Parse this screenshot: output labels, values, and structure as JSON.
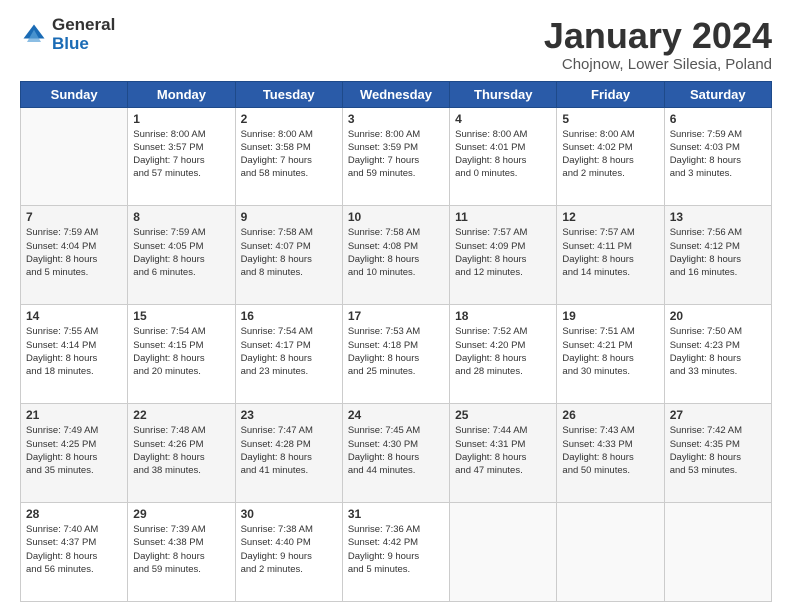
{
  "logo": {
    "general": "General",
    "blue": "Blue"
  },
  "title": {
    "month": "January 2024",
    "location": "Chojnow, Lower Silesia, Poland"
  },
  "weekdays": [
    "Sunday",
    "Monday",
    "Tuesday",
    "Wednesday",
    "Thursday",
    "Friday",
    "Saturday"
  ],
  "weeks": [
    [
      {
        "day": "",
        "sunrise": "",
        "sunset": "",
        "daylight": ""
      },
      {
        "day": "1",
        "sunrise": "Sunrise: 8:00 AM",
        "sunset": "Sunset: 3:57 PM",
        "daylight": "Daylight: 7 hours and 57 minutes."
      },
      {
        "day": "2",
        "sunrise": "Sunrise: 8:00 AM",
        "sunset": "Sunset: 3:58 PM",
        "daylight": "Daylight: 7 hours and 58 minutes."
      },
      {
        "day": "3",
        "sunrise": "Sunrise: 8:00 AM",
        "sunset": "Sunset: 3:59 PM",
        "daylight": "Daylight: 7 hours and 59 minutes."
      },
      {
        "day": "4",
        "sunrise": "Sunrise: 8:00 AM",
        "sunset": "Sunset: 4:01 PM",
        "daylight": "Daylight: 8 hours and 0 minutes."
      },
      {
        "day": "5",
        "sunrise": "Sunrise: 8:00 AM",
        "sunset": "Sunset: 4:02 PM",
        "daylight": "Daylight: 8 hours and 2 minutes."
      },
      {
        "day": "6",
        "sunrise": "Sunrise: 7:59 AM",
        "sunset": "Sunset: 4:03 PM",
        "daylight": "Daylight: 8 hours and 3 minutes."
      }
    ],
    [
      {
        "day": "7",
        "sunrise": "Sunrise: 7:59 AM",
        "sunset": "Sunset: 4:04 PM",
        "daylight": "Daylight: 8 hours and 5 minutes."
      },
      {
        "day": "8",
        "sunrise": "Sunrise: 7:59 AM",
        "sunset": "Sunset: 4:05 PM",
        "daylight": "Daylight: 8 hours and 6 minutes."
      },
      {
        "day": "9",
        "sunrise": "Sunrise: 7:58 AM",
        "sunset": "Sunset: 4:07 PM",
        "daylight": "Daylight: 8 hours and 8 minutes."
      },
      {
        "day": "10",
        "sunrise": "Sunrise: 7:58 AM",
        "sunset": "Sunset: 4:08 PM",
        "daylight": "Daylight: 8 hours and 10 minutes."
      },
      {
        "day": "11",
        "sunrise": "Sunrise: 7:57 AM",
        "sunset": "Sunset: 4:09 PM",
        "daylight": "Daylight: 8 hours and 12 minutes."
      },
      {
        "day": "12",
        "sunrise": "Sunrise: 7:57 AM",
        "sunset": "Sunset: 4:11 PM",
        "daylight": "Daylight: 8 hours and 14 minutes."
      },
      {
        "day": "13",
        "sunrise": "Sunrise: 7:56 AM",
        "sunset": "Sunset: 4:12 PM",
        "daylight": "Daylight: 8 hours and 16 minutes."
      }
    ],
    [
      {
        "day": "14",
        "sunrise": "Sunrise: 7:55 AM",
        "sunset": "Sunset: 4:14 PM",
        "daylight": "Daylight: 8 hours and 18 minutes."
      },
      {
        "day": "15",
        "sunrise": "Sunrise: 7:54 AM",
        "sunset": "Sunset: 4:15 PM",
        "daylight": "Daylight: 8 hours and 20 minutes."
      },
      {
        "day": "16",
        "sunrise": "Sunrise: 7:54 AM",
        "sunset": "Sunset: 4:17 PM",
        "daylight": "Daylight: 8 hours and 23 minutes."
      },
      {
        "day": "17",
        "sunrise": "Sunrise: 7:53 AM",
        "sunset": "Sunset: 4:18 PM",
        "daylight": "Daylight: 8 hours and 25 minutes."
      },
      {
        "day": "18",
        "sunrise": "Sunrise: 7:52 AM",
        "sunset": "Sunset: 4:20 PM",
        "daylight": "Daylight: 8 hours and 28 minutes."
      },
      {
        "day": "19",
        "sunrise": "Sunrise: 7:51 AM",
        "sunset": "Sunset: 4:21 PM",
        "daylight": "Daylight: 8 hours and 30 minutes."
      },
      {
        "day": "20",
        "sunrise": "Sunrise: 7:50 AM",
        "sunset": "Sunset: 4:23 PM",
        "daylight": "Daylight: 8 hours and 33 minutes."
      }
    ],
    [
      {
        "day": "21",
        "sunrise": "Sunrise: 7:49 AM",
        "sunset": "Sunset: 4:25 PM",
        "daylight": "Daylight: 8 hours and 35 minutes."
      },
      {
        "day": "22",
        "sunrise": "Sunrise: 7:48 AM",
        "sunset": "Sunset: 4:26 PM",
        "daylight": "Daylight: 8 hours and 38 minutes."
      },
      {
        "day": "23",
        "sunrise": "Sunrise: 7:47 AM",
        "sunset": "Sunset: 4:28 PM",
        "daylight": "Daylight: 8 hours and 41 minutes."
      },
      {
        "day": "24",
        "sunrise": "Sunrise: 7:45 AM",
        "sunset": "Sunset: 4:30 PM",
        "daylight": "Daylight: 8 hours and 44 minutes."
      },
      {
        "day": "25",
        "sunrise": "Sunrise: 7:44 AM",
        "sunset": "Sunset: 4:31 PM",
        "daylight": "Daylight: 8 hours and 47 minutes."
      },
      {
        "day": "26",
        "sunrise": "Sunrise: 7:43 AM",
        "sunset": "Sunset: 4:33 PM",
        "daylight": "Daylight: 8 hours and 50 minutes."
      },
      {
        "day": "27",
        "sunrise": "Sunrise: 7:42 AM",
        "sunset": "Sunset: 4:35 PM",
        "daylight": "Daylight: 8 hours and 53 minutes."
      }
    ],
    [
      {
        "day": "28",
        "sunrise": "Sunrise: 7:40 AM",
        "sunset": "Sunset: 4:37 PM",
        "daylight": "Daylight: 8 hours and 56 minutes."
      },
      {
        "day": "29",
        "sunrise": "Sunrise: 7:39 AM",
        "sunset": "Sunset: 4:38 PM",
        "daylight": "Daylight: 8 hours and 59 minutes."
      },
      {
        "day": "30",
        "sunrise": "Sunrise: 7:38 AM",
        "sunset": "Sunset: 4:40 PM",
        "daylight": "Daylight: 9 hours and 2 minutes."
      },
      {
        "day": "31",
        "sunrise": "Sunrise: 7:36 AM",
        "sunset": "Sunset: 4:42 PM",
        "daylight": "Daylight: 9 hours and 5 minutes."
      },
      {
        "day": "",
        "sunrise": "",
        "sunset": "",
        "daylight": ""
      },
      {
        "day": "",
        "sunrise": "",
        "sunset": "",
        "daylight": ""
      },
      {
        "day": "",
        "sunrise": "",
        "sunset": "",
        "daylight": ""
      }
    ]
  ]
}
